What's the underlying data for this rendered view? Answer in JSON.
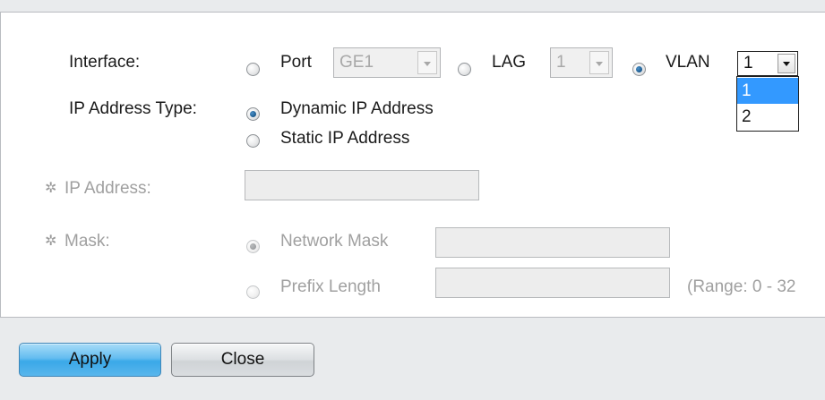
{
  "form": {
    "interface_label": "Interface:",
    "port": {
      "label": "Port",
      "value": "GE1",
      "selected": false
    },
    "lag": {
      "label": "LAG",
      "value": "1",
      "selected": false
    },
    "vlan": {
      "label": "VLAN",
      "value": "1",
      "selected": true,
      "options": [
        "1",
        "2"
      ],
      "highlighted": "1"
    },
    "ip_type_label": "IP Address Type:",
    "ip_type_options": [
      "Dynamic IP Address",
      "Static IP Address"
    ],
    "ip_type_selected": "Dynamic IP Address",
    "ip_address_label": "IP Address:",
    "ip_address_value": "",
    "mask_label": "Mask:",
    "network_mask_label": "Network Mask",
    "network_mask_value": "",
    "prefix_length_label": "Prefix Length",
    "prefix_length_value": "",
    "range_hint": "(Range: 0 - 32"
  },
  "buttons": {
    "apply": "Apply",
    "close": "Close"
  },
  "icons": {
    "required_marker": "gear-icon"
  },
  "colors": {
    "background": "#e9ebed",
    "panel": "#ffffff",
    "highlight": "#3399ff",
    "apply_button": "#3aa8e8",
    "disabled_text": "#a0a0a0"
  }
}
